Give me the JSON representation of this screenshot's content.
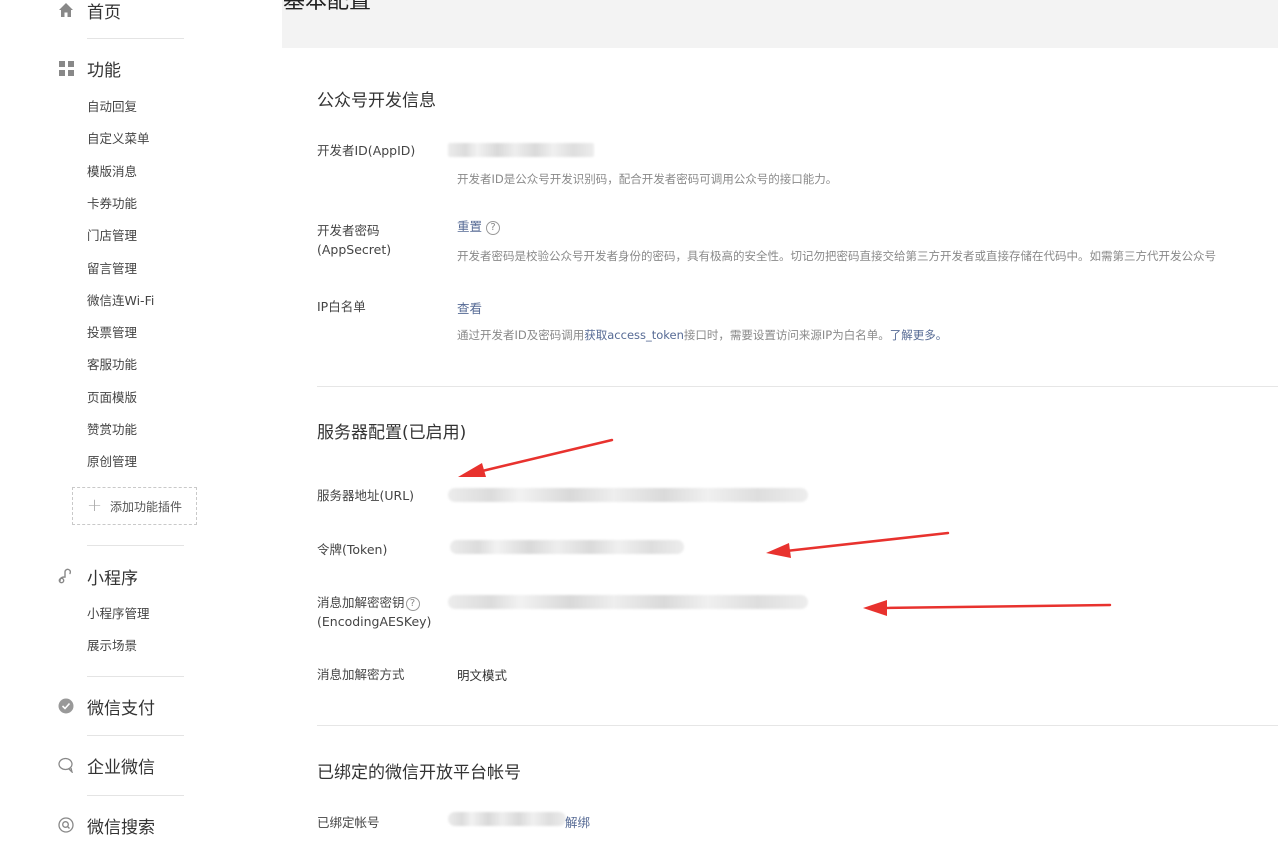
{
  "sidebar": {
    "home": {
      "label": "首页",
      "icon": "home-icon"
    },
    "functions": {
      "label": "功能",
      "icon": "grid-icon",
      "items": [
        "自动回复",
        "自定义菜单",
        "模版消息",
        "卡券功能",
        "门店管理",
        "留言管理",
        "微信连Wi-Fi",
        "投票管理",
        "客服功能",
        "页面模版",
        "赞赏功能",
        "原创管理"
      ],
      "add_plugin": "添加功能插件"
    },
    "miniprogram": {
      "label": "小程序",
      "icon": "link-icon",
      "items": [
        "小程序管理",
        "展示场景"
      ]
    },
    "wechat_pay": {
      "label": "微信支付",
      "icon": "wechat-pay-icon"
    },
    "work_wechat": {
      "label": "企业微信",
      "icon": "chat-bubble-icon"
    },
    "wechat_search": {
      "label": "微信搜索",
      "icon": "search-icon"
    }
  },
  "page": {
    "title": "基本配置"
  },
  "dev_info": {
    "title": "公众号开发信息",
    "appid_label": "开发者ID(AppID)",
    "appid_hint": "开发者ID是公众号开发识别码，配合开发者密码可调用公众号的接口能力。",
    "secret_label_1": "开发者密码",
    "secret_label_2": "(AppSecret)",
    "secret_reset": "重置",
    "secret_hint": "开发者密码是校验公众号开发者身份的密码，具有极高的安全性。切记勿把密码直接交给第三方开发者或直接存储在代码中。如需第三方代开发公众号",
    "ip_label": "IP白名单",
    "ip_view": "查看",
    "ip_hint_prefix": "通过开发者ID及密码调用",
    "ip_hint_link": "获取access_token",
    "ip_hint_middle": "接口时，需要设置访问来源IP为白名单。",
    "ip_hint_more": "了解更多。"
  },
  "server_config": {
    "title": "服务器配置(已启用)",
    "url_label": "服务器地址(URL)",
    "token_label": "令牌(Token)",
    "aes_label_1": "消息加解密密钥",
    "aes_label_2": "(EncodingAESKey)",
    "mode_label": "消息加解密方式",
    "mode_value": "明文模式"
  },
  "open_platform": {
    "title": "已绑定的微信开放平台帐号",
    "bound_label": "已绑定帐号",
    "unbind": "解绑"
  },
  "colors": {
    "link": "#576b95",
    "arrow": "#e8322e"
  }
}
